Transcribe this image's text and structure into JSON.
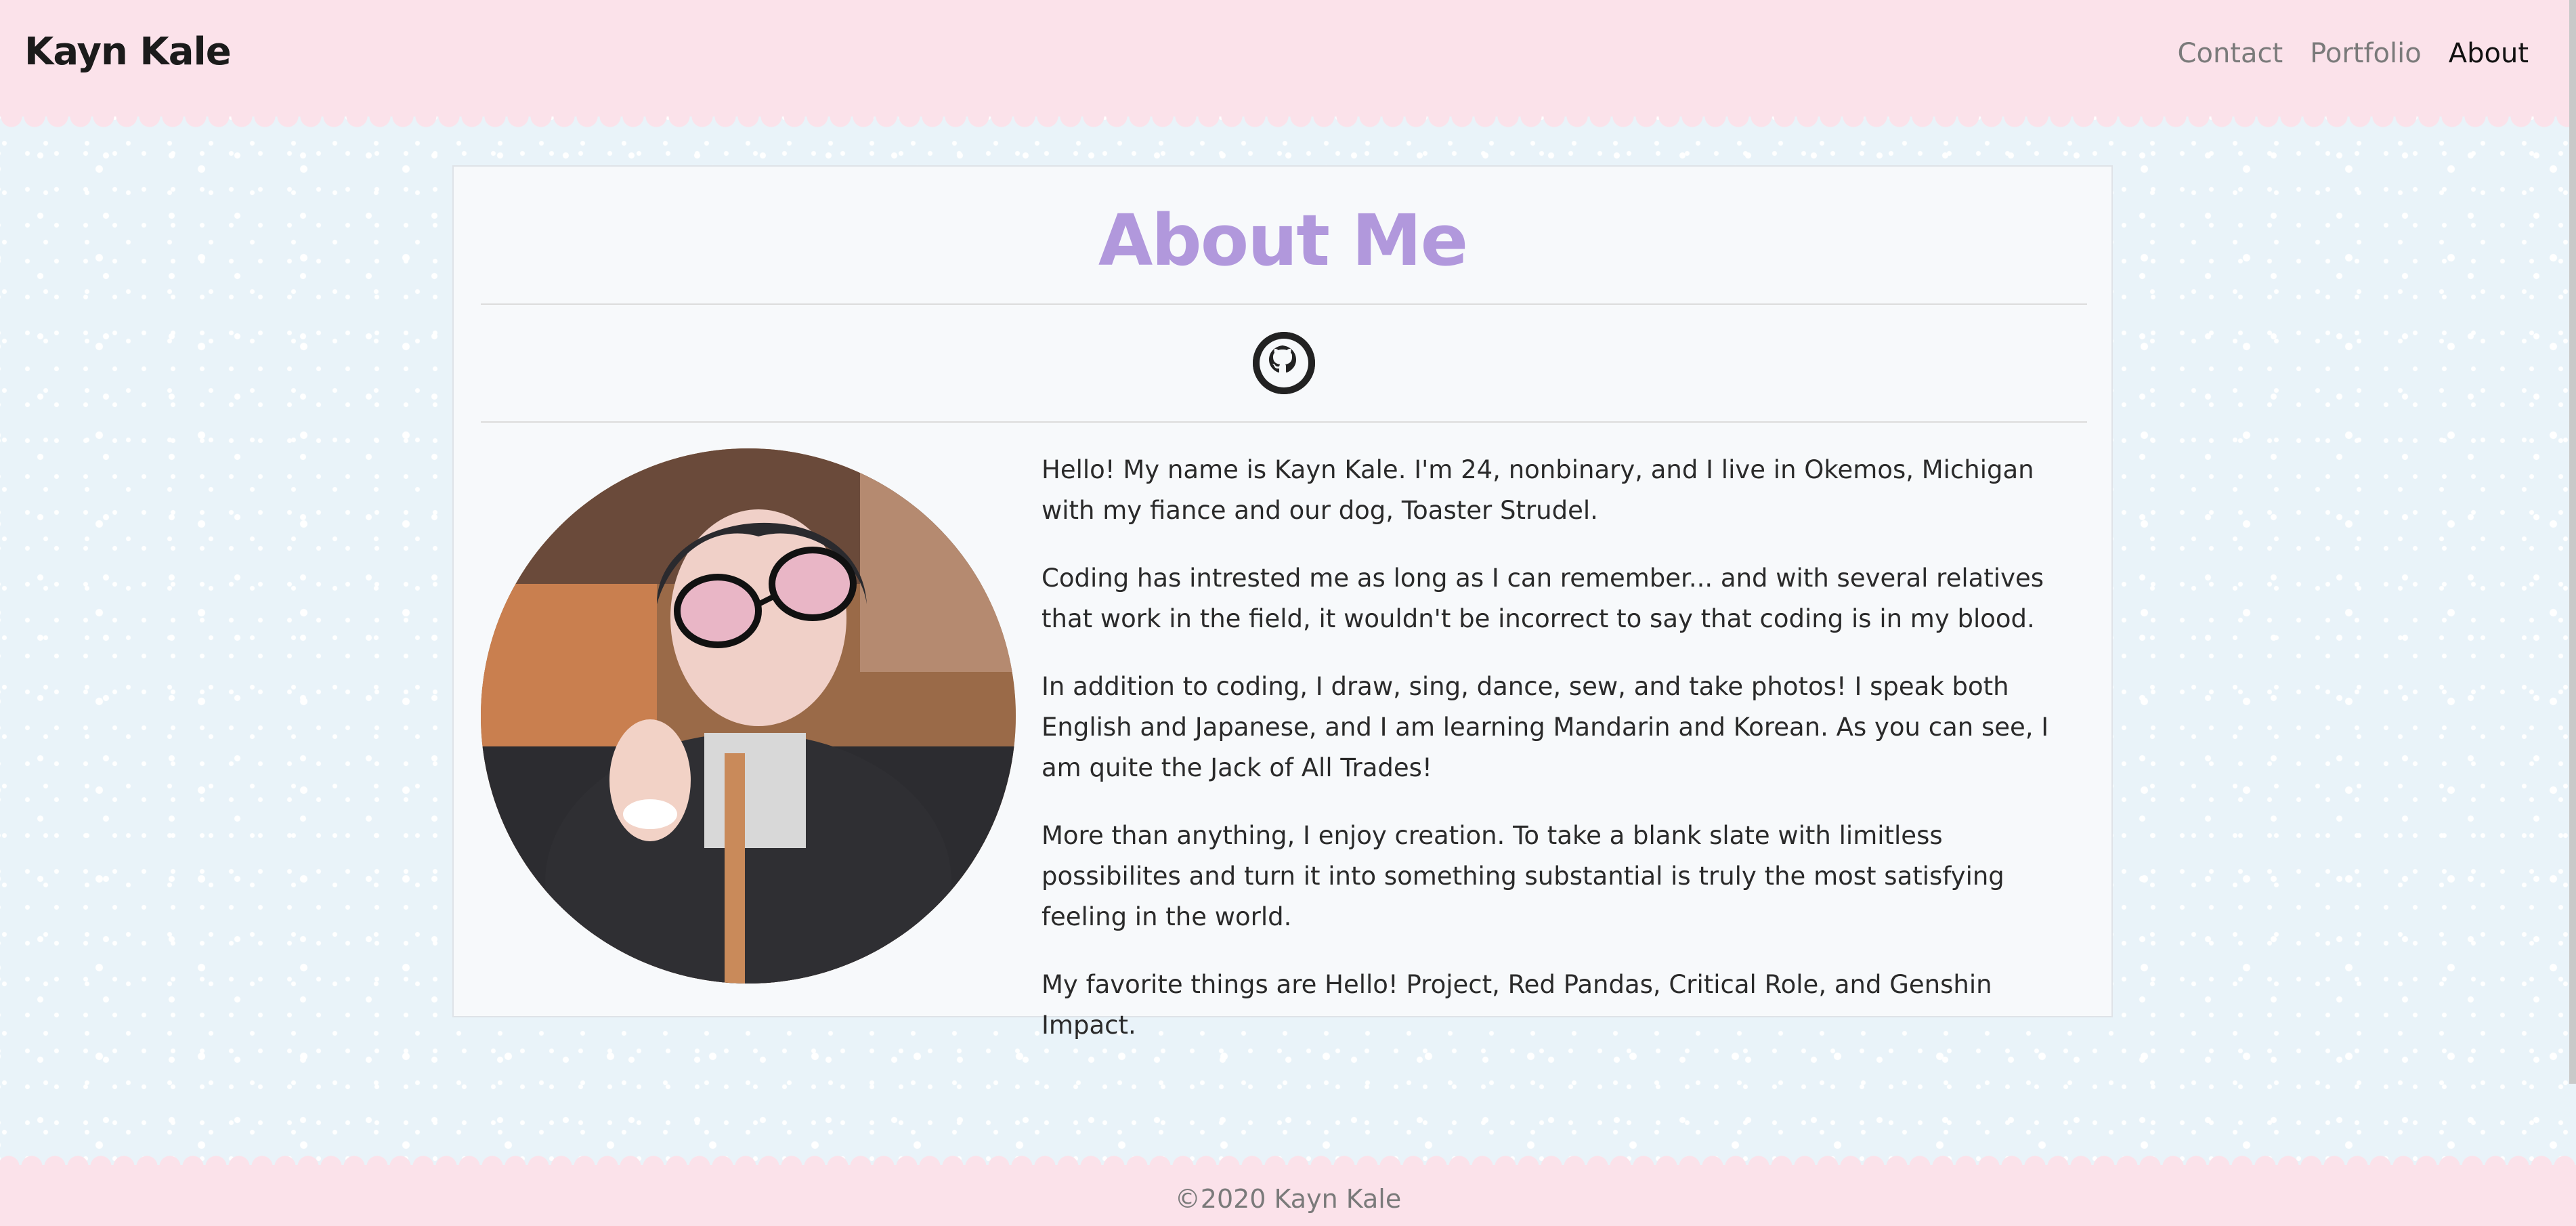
{
  "header": {
    "brand": "Kayn Kale",
    "nav": [
      {
        "label": "Contact"
      },
      {
        "label": "Portfolio"
      },
      {
        "label": "About"
      }
    ]
  },
  "main": {
    "title": "About Me",
    "github_icon": "github-icon",
    "paragraphs": [
      "Hello! My name is Kayn Kale. I'm 24, nonbinary, and I live in Okemos, Michigan with my fiance and our dog, Toaster Strudel.",
      "Coding has intrested me as long as I can remember... and with several relatives that work in the field, it wouldn't be incorrect to say that coding is in my blood.",
      "In addition to coding, I draw, sing, dance, sew, and take photos! I speak both English and Japanese, and I am learning Mandarin and Korean. As you can see, I am quite the Jack of All Trades!",
      "More than anything, I enjoy creation. To take a blank slate with limitless possibilites and turn it into something substantial is truly the most satisfying feeling in the world.",
      "My favorite things are Hello! Project, Red Pandas, Critical Role, and Genshin Impact."
    ]
  },
  "footer": {
    "copyright": "©2020 Kayn Kale"
  },
  "colors": {
    "header_bg": "#fbe2ea",
    "page_bg": "#e9f3f9",
    "title": "#b198dc",
    "card_bg": "#f7f9fb"
  }
}
